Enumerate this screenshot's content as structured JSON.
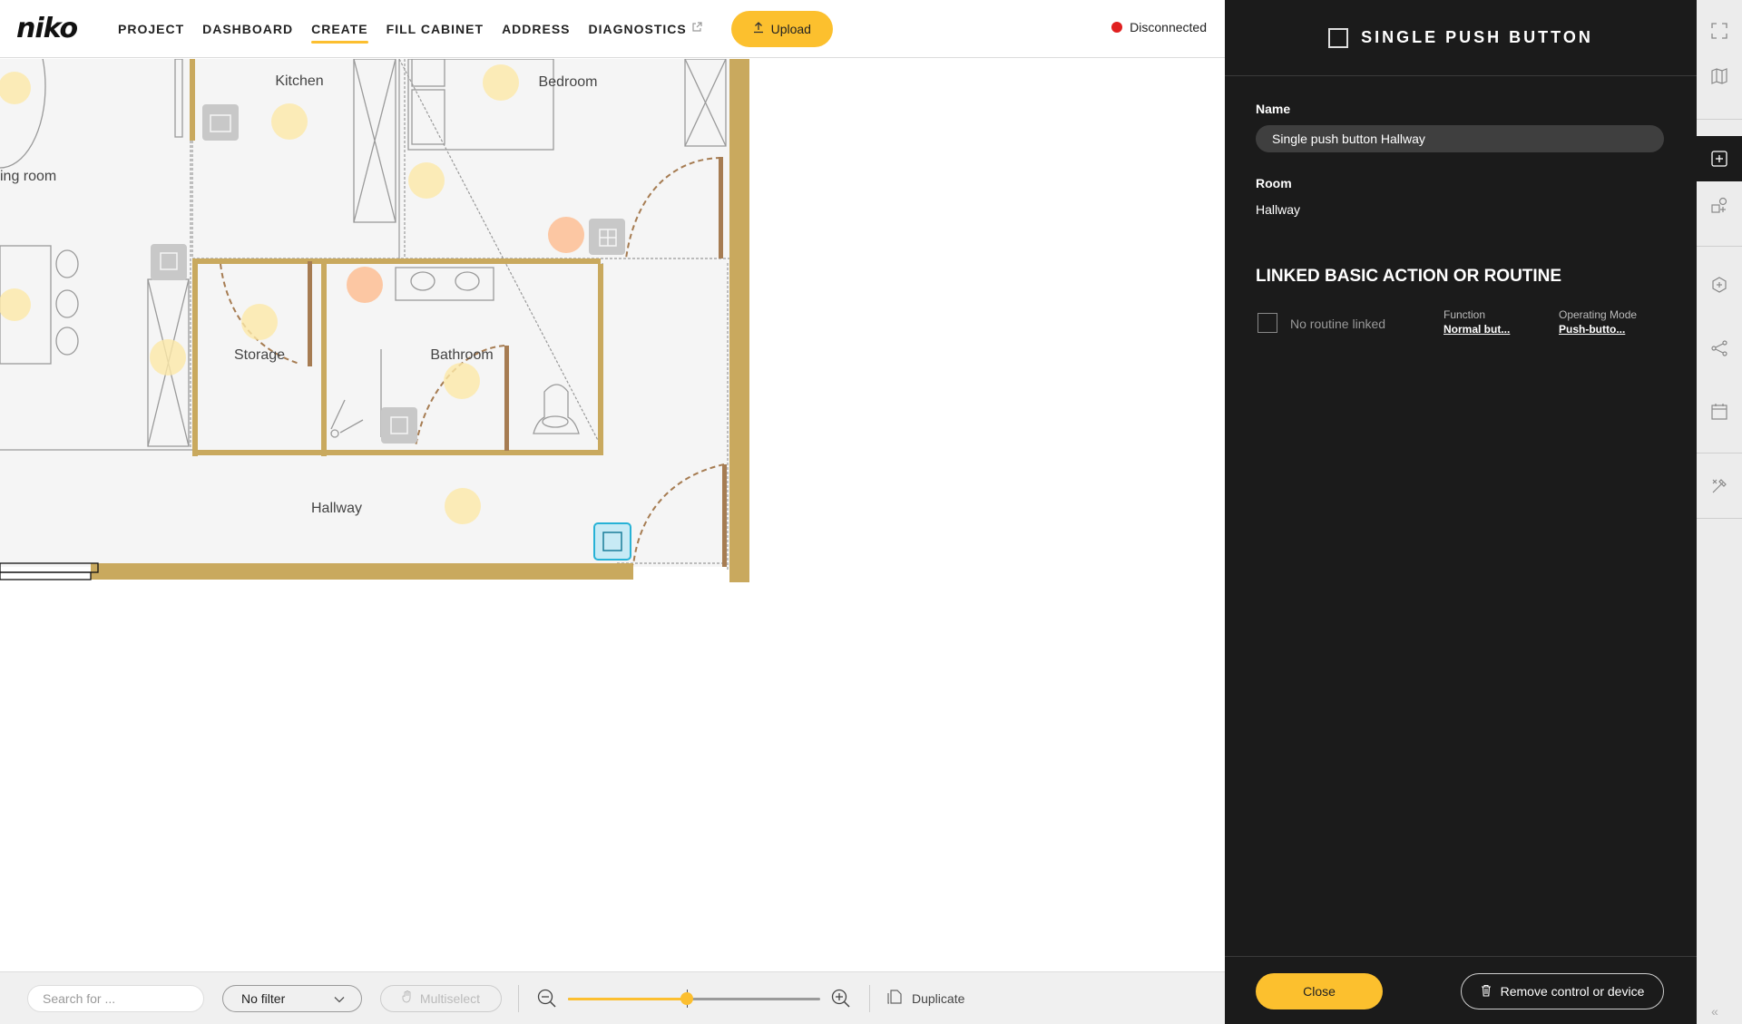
{
  "app": {
    "logo": "niko"
  },
  "nav": {
    "items": [
      {
        "label": "PROJECT"
      },
      {
        "label": "DASHBOARD"
      },
      {
        "label": "CREATE"
      },
      {
        "label": "FILL CABINET"
      },
      {
        "label": "ADDRESS"
      },
      {
        "label": "DIAGNOSTICS"
      }
    ],
    "active": "CREATE",
    "upload_label": "Upload"
  },
  "status": {
    "text": "Disconnected",
    "color": "#e02020"
  },
  "floorplan": {
    "rooms": [
      {
        "name": "Kitchen"
      },
      {
        "name": "Bedroom"
      },
      {
        "name": "ing room"
      },
      {
        "name": "Storage"
      },
      {
        "name": "Bathroom"
      },
      {
        "name": "Hallway"
      }
    ],
    "wall_color": "#c9a95e",
    "selected_color": "#27b2d6"
  },
  "toolbar": {
    "search_placeholder": "Search for ...",
    "filter_value": "No filter",
    "multiselect_label": "Multiselect",
    "zoom_level_fraction": 0.47,
    "duplicate_label": "Duplicate"
  },
  "panel": {
    "title": "SINGLE PUSH BUTTON",
    "name_label": "Name",
    "name_value": "Single push button Hallway",
    "room_label": "Room",
    "room_value": "Hallway",
    "section_title": "LINKED BASIC ACTION OR ROUTINE",
    "routine": {
      "text": "No routine linked",
      "function_label": "Function",
      "function_value": "Normal but...",
      "mode_label": "Operating Mode",
      "mode_value": "Push-butto..."
    },
    "close_label": "Close",
    "remove_label": "Remove control or device"
  },
  "colors": {
    "accent": "#fcc02e",
    "panel_bg": "#1b1b1b"
  }
}
